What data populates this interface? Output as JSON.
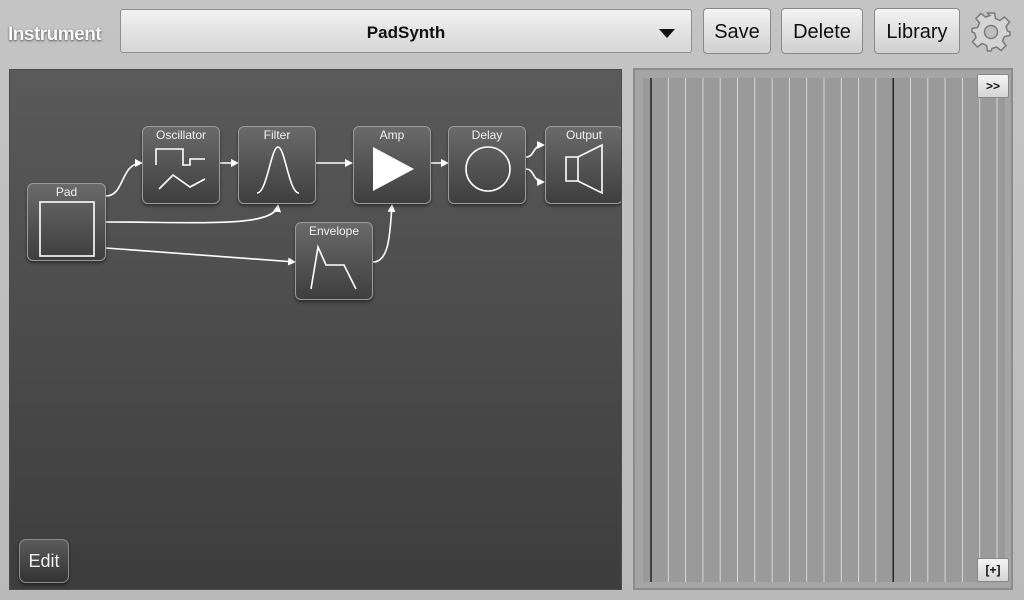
{
  "header": {
    "instrument_label": "Instrument",
    "selected_instrument": "PadSynth",
    "save_label": "Save",
    "delete_label": "Delete",
    "library_label": "Library",
    "settings_icon": "gear-icon"
  },
  "patch": {
    "modules": {
      "pad": {
        "label": "Pad",
        "icon": "pad-square-icon"
      },
      "oscillator": {
        "label": "Oscillator",
        "icon": "waveform-icon"
      },
      "filter": {
        "label": "Filter",
        "icon": "filter-curve-icon"
      },
      "amp": {
        "label": "Amp",
        "icon": "amp-triangle-icon"
      },
      "delay": {
        "label": "Delay",
        "icon": "delay-circle-icon"
      },
      "output": {
        "label": "Output",
        "icon": "speaker-icon"
      },
      "envelope": {
        "label": "Envelope",
        "icon": "envelope-shape-icon"
      }
    },
    "edit_label": "Edit"
  },
  "sequencer": {
    "expand_label": ">>",
    "add_label": "[+]"
  },
  "colors": {
    "wire": "#ffffff",
    "patch_background": "#4a4a4a",
    "sequencer_background": "#a5a5a5"
  }
}
